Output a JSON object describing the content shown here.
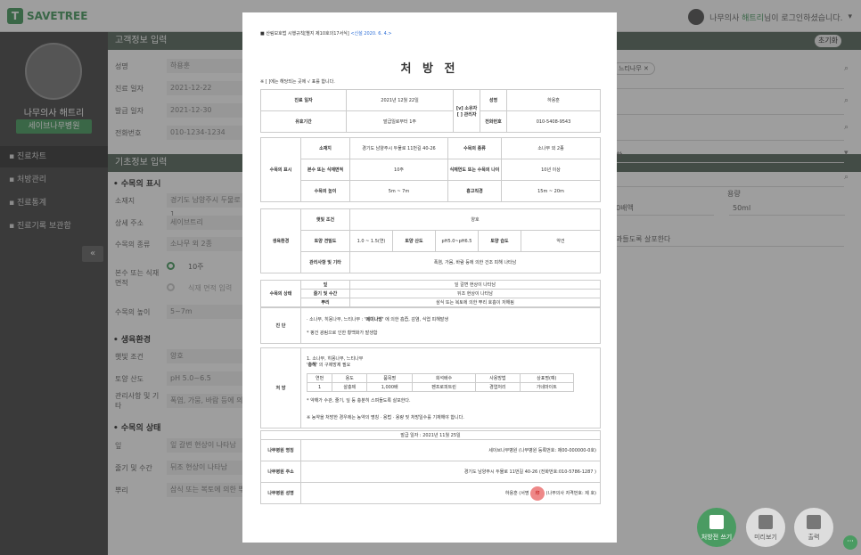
{
  "app": {
    "logo": "SAVETREE",
    "user_name": "나무의사 해트리",
    "user_suffix": "님이 로그인하셨습니다.",
    "user_prefix": "나무의사 "
  },
  "sidebar": {
    "name": "나무의사 해트리",
    "hospital": "세이브나무병원",
    "items": [
      {
        "label": "진료차트"
      },
      {
        "label": "처방관리"
      },
      {
        "label": "진료통계"
      },
      {
        "label": "진료기록 보관함"
      }
    ],
    "collapse": "«"
  },
  "sections": {
    "customer": "고객정보 입력",
    "basic": "기초정보 입력",
    "tree": "수목의 표시",
    "growth": "생육환경",
    "status": "수목의 상태"
  },
  "customer": {
    "name_l": "성명",
    "name_v": "하용훈",
    "date_l": "진료 일자",
    "date_v": "2021-12-22",
    "issue_l": "발급 일자",
    "issue_v": "2021-12-30",
    "phone_l": "전화번호",
    "phone_v": "010-1234-1234"
  },
  "tree": {
    "loc_l": "소재지",
    "loc_v": "경기도 남양주시 두물로 1",
    "addr_l": "상세 주소",
    "addr_v": "세이브트리",
    "kind_l": "수목의 종류",
    "kind_v": "소나무 외 2종",
    "count_l": "본수 또는 식재 면적",
    "count_v": "10주",
    "area_v": "식재 면적 입력",
    "height_l": "수목의 높이",
    "height_v": "5~7m"
  },
  "growth": {
    "sun_l": "햇빛 조건",
    "sun_v": "양호",
    "ph_l": "토양 산도",
    "ph_v": "pH  5.0~6.5",
    "mgmt_l": "관리사항 및 기타",
    "mgmt_v": "폭염, 가뭄, 바람 등에 의"
  },
  "status": {
    "leaf_l": "잎",
    "leaf_v": "잎 갈변 현상이 나타남",
    "stem_l": "줄기 및 수간",
    "stem_v": "뒤조 현상이 나타남",
    "root_l": "뿌리",
    "root_v": "삼식 또는 복토에 의한 뿌"
  },
  "right": {
    "init_btn": "초기화",
    "chip": "느티나무",
    "dose_l": "용량",
    "dose_v": "50ml",
    "mult_v": "0배액",
    "note_v": "과들도록 살포한다",
    "combo": "합"
  },
  "fabs": {
    "write": "처방전 쓰기",
    "preview": "미리보기",
    "print": "출력"
  },
  "doc": {
    "src": "■ 산림보호법 시행규칙[별지 제10호의17서식]",
    "src_hl": "<신설 2020. 6. 4.>",
    "title": "처 방 전",
    "note": "※ [  ]에는 해당되는 곳에 √ 표를 합니다.",
    "top": {
      "date_l": "진료 일자",
      "date_v": "2021년 12월 22일",
      "owner_l": "[v] 소유자 [ ] 관리자",
      "name_l": "성명",
      "name_v": "하용훈",
      "valid_l": "유효기간",
      "valid_v": "발급일로부터 1주",
      "tel_l": "전화번호",
      "tel_v": "010-5408-9543"
    },
    "tree": {
      "head": "수목의 표시",
      "loc_l": "소재지",
      "loc_v": "경기도 남양주시 두물로 11번길 40-26",
      "kind_l": "수목의 종류",
      "kind_v": "소나무 외 2종",
      "cnt_l": "본수 또는 식재면적",
      "cnt_v": "10주",
      "age_l": "식재연도 또는 수목의 나이",
      "age_v": "10년 이상",
      "h_l": "수목의 높이",
      "h_v": "5m ~ 7m",
      "dbh_l": "흉고직경",
      "dbh_v": "15m ~ 20m"
    },
    "growth": {
      "head": "생육환경",
      "sun_l": "햇빛 조건",
      "sun_v": "양호",
      "soil_l": "토양 견밀도",
      "soil_v": "1.0 ~ 1.5(연)",
      "ph_l": "토양 산도",
      "ph_v": "pH5.0~pH6.5",
      "moist_l": "토양 습도",
      "moist_v": "약건",
      "etc_l": "관리사항 및 기타",
      "etc_v": "폭염, 가뭄, 바람 등에 의한 건조 피해 나타남"
    },
    "state": {
      "head": "수목의 상태",
      "leaf_l": "잎",
      "leaf_v": "잎 갈변 현상이 나타남",
      "stem_l": "줄기 및 수간",
      "stem_v": "뒤조 현상이 나타남",
      "root_l": "뿌리",
      "root_v": "삼식 또는 복토에 의한 뿌리 호흡이 저해됨"
    },
    "diag": {
      "head": "진 단",
      "l1a": "· 소나무, 히몽나무, 느티나무 : ",
      "l1b": "'메미나방'",
      "l1c": " 에 의한 흡즙, 감염, 식엽 피해발생",
      "l2": "* 펑건 광림으로 인한 황백화가 발생함"
    },
    "presc": {
      "head": "처 방",
      "l1": "1. 소나무, 히몽나무, 느티나무",
      "l2a": "'충해'",
      "l2b": " 의 구제방제 필요",
      "cols": [
        "연번",
        "용도",
        "품목명",
        "희석배수",
        "사용방법",
        "상표명(예)"
      ],
      "row": [
        "1",
        "살충제",
        "품목명",
        "1,000배",
        "펜프로피트린",
        "경엽처리",
        "가네마이트"
      ],
      "l3": "* 약해가 수관, 줄기, 잎 등 충분히 스며들도록 살포한다.",
      "l4": "※ 농약을 처방한 경우에는 농약의 명칭 · 용법 · 용량 및 처방일수를 기재해야 합니다."
    },
    "issue": "발급 일자 : 2021년 11월 25일",
    "hosp_name_l": "나무병원 명칭",
    "hosp_name_v": "세이브나무병원 (나무병원 등록번호: 제00-000000-0호)",
    "hosp_addr_l": "나무병원 주소",
    "hosp_addr_v": "경기도 남양주시 두물로 11번길 40-26 (전화번호:010-5786-1287 )",
    "doctor_l": "나무병원 성명",
    "doctor_v": "하용훈 (서명",
    "doctor_v2": "(나무의사 자격번호: 제 호)",
    "seal": "印"
  }
}
